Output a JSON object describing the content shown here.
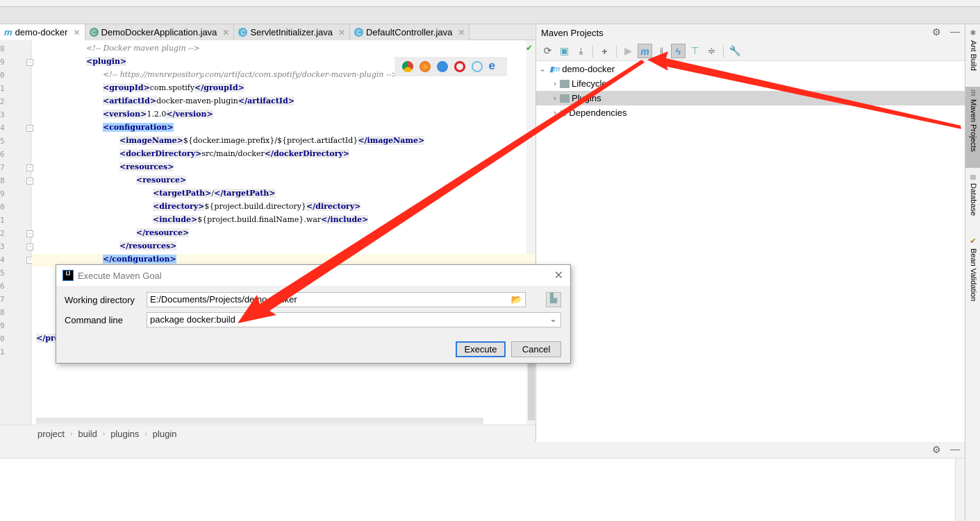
{
  "tabs": [
    {
      "label": "demo-docker",
      "icon": "maven-icon",
      "active": true
    },
    {
      "label": "DemoDockerApplication.java",
      "icon": "spring-boot-class-icon"
    },
    {
      "label": "ServletInitializer.java",
      "icon": "class-icon"
    },
    {
      "label": "DefaultController.java",
      "icon": "class-icon"
    }
  ],
  "gutter": {
    "line_numbers": [
      "8",
      "9",
      "0",
      "1",
      "2",
      "3",
      "4",
      "5",
      "6",
      "7",
      "8",
      "9",
      "0",
      "1",
      "2",
      "3",
      "4",
      "5",
      "6",
      "7",
      "8",
      "9",
      "0",
      "1"
    ]
  },
  "code": [
    {
      "comment": "<!-- Docker maven plugin -->"
    },
    {
      "open": "<plugin>"
    },
    {
      "comment": "<!-- https://mvnrepository.com/artifact/com.spotify/docker-maven-plugin -->"
    },
    {
      "open": "<groupId>",
      "text": "com.spotify",
      "close": "</groupId>"
    },
    {
      "open": "<artifactId>",
      "text": "docker-maven-plugin",
      "close": "</artifactId>"
    },
    {
      "open": "<version>",
      "text": "1.2.0",
      "close": "</version>"
    },
    {
      "open": "<configuration>"
    },
    {
      "open": "<imageName>",
      "text": "${docker.image.prefix}/${project.artifactId}",
      "close": "</imageName>"
    },
    {
      "open": "<dockerDirectory>",
      "text": "src/main/docker",
      "close": "</dockerDirectory>"
    },
    {
      "open": "<resources>"
    },
    {
      "open": "<resource>"
    },
    {
      "open": "<targetPath>",
      "text": "/",
      "close": "</targetPath>"
    },
    {
      "open": "<directory>",
      "text": "${project.build.directory}",
      "close": "</directory>"
    },
    {
      "open": "<include>",
      "text": "${project.build.finalName}.war",
      "close": "</include>"
    },
    {
      "close": "</resource>"
    },
    {
      "close": "</resources>"
    },
    {
      "close": "</configuration>"
    },
    {
      "close": "</pro"
    }
  ],
  "breadcrumb": [
    "project",
    "build",
    "plugins",
    "plugin"
  ],
  "maven": {
    "title": "Maven Projects",
    "toolbar": [
      "reimport-icon",
      "generate-sources-icon",
      "download-icon",
      "add-icon",
      "run-icon",
      "execute-goal-icon",
      "toggle-offline-icon",
      "skip-tests-icon",
      "show-dependencies-icon",
      "collapse-all-icon",
      "settings-wrench-icon"
    ],
    "tree": {
      "root": "demo-docker",
      "children": [
        "Lifecycle",
        "Plugins",
        "Dependencies"
      ],
      "selected": "Plugins"
    }
  },
  "right_strip": [
    "Ant Build",
    "Maven Projects",
    "Database",
    "Bean Validation"
  ],
  "dialog": {
    "title": "Execute Maven Goal",
    "working_directory_label": "Working directory",
    "working_directory_value": "E:/Documents/Projects/demo-docker",
    "command_line_label": "Command line",
    "command_line_value": "package docker:build",
    "execute_label": "Execute",
    "cancel_label": "Cancel"
  },
  "annotation_color": "#ff2a1a"
}
